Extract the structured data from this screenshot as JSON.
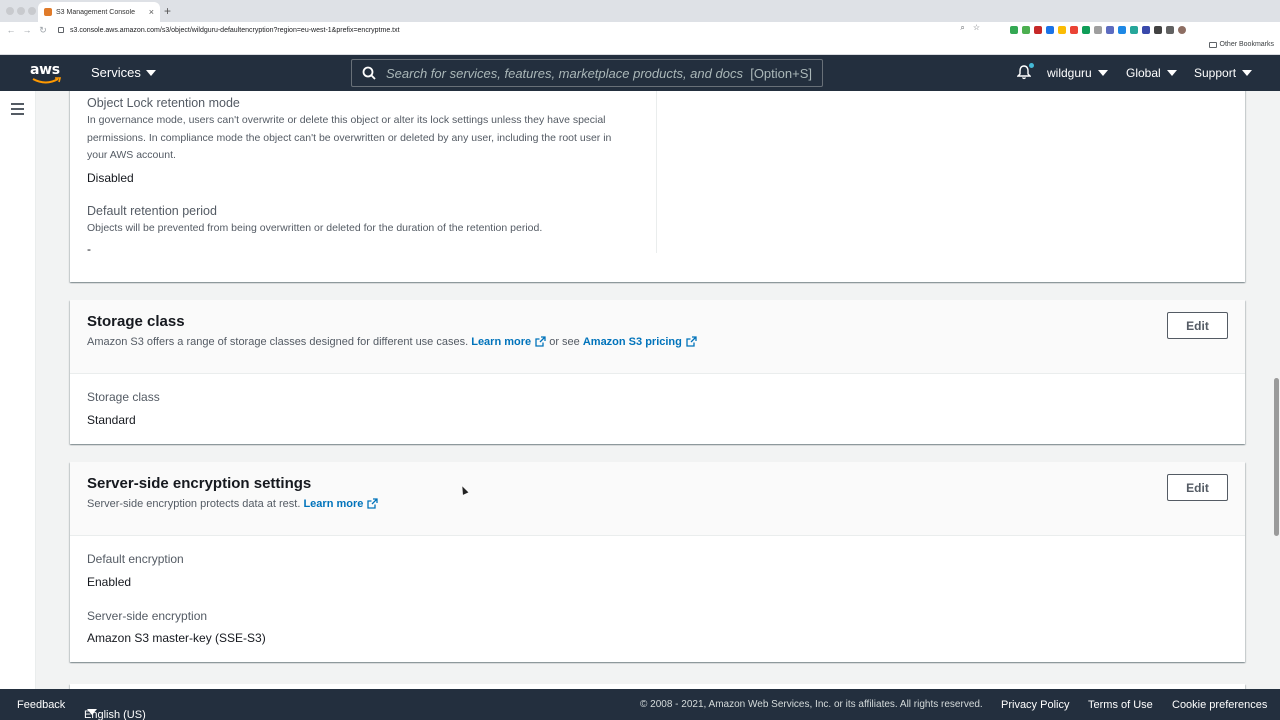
{
  "browser": {
    "tab_title": "S3 Management Console",
    "tab_close": "×",
    "new_tab": "+",
    "url": "s3.console.aws.amazon.com/s3/object/wildguru-defaultencryption?region=eu-west-1&prefix=encryptme.txt",
    "other_bookmarks": "Other Bookmarks"
  },
  "nav": {
    "services_label": "Services",
    "search_placeholder": "Search for services, features, marketplace products, and docs",
    "search_shortcut": "[Option+S]",
    "account_label": "wildguru",
    "region_label": "Global",
    "support_label": "Support"
  },
  "object_lock": {
    "mode_label": "Object Lock retention mode",
    "mode_help_1": "In governance mode, users can't overwrite or delete this object or alter its lock settings unless they have special",
    "mode_help_2": "permissions. In compliance mode the object can't be overwritten or deleted by any user, including the root user in",
    "mode_help_3": "your AWS account.",
    "mode_value": "Disabled",
    "period_label": "Default retention period",
    "period_help": "Objects will be prevented from being overwritten or deleted for the duration of the retention period.",
    "period_value": "-"
  },
  "storage_class": {
    "title": "Storage class",
    "desc_prefix": "Amazon S3 offers a range of storage classes designed for different use cases.",
    "learn_more": "Learn more",
    "or_see": "or see",
    "pricing_link": "Amazon S3 pricing",
    "edit_label": "Edit",
    "field_label": "Storage class",
    "field_value": "Standard"
  },
  "encryption": {
    "title": "Server-side encryption settings",
    "desc_prefix": "Server-side encryption protects data at rest.",
    "learn_more": "Learn more",
    "edit_label": "Edit",
    "default_label": "Default encryption",
    "default_value": "Enabled",
    "sse_label": "Server-side encryption",
    "sse_value": "Amazon S3 master-key (SSE-S3)"
  },
  "footer": {
    "feedback": "Feedback",
    "language": "English (US)",
    "copyright": "© 2008 - 2021, Amazon Web Services, Inc. or its affiliates. All rights reserved.",
    "privacy": "Privacy Policy",
    "terms": "Terms of Use",
    "cookies": "Cookie preferences"
  },
  "colors": {
    "nav_bg": "#232f3e",
    "link": "#0073bb",
    "page_bg": "#f2f3f3"
  }
}
